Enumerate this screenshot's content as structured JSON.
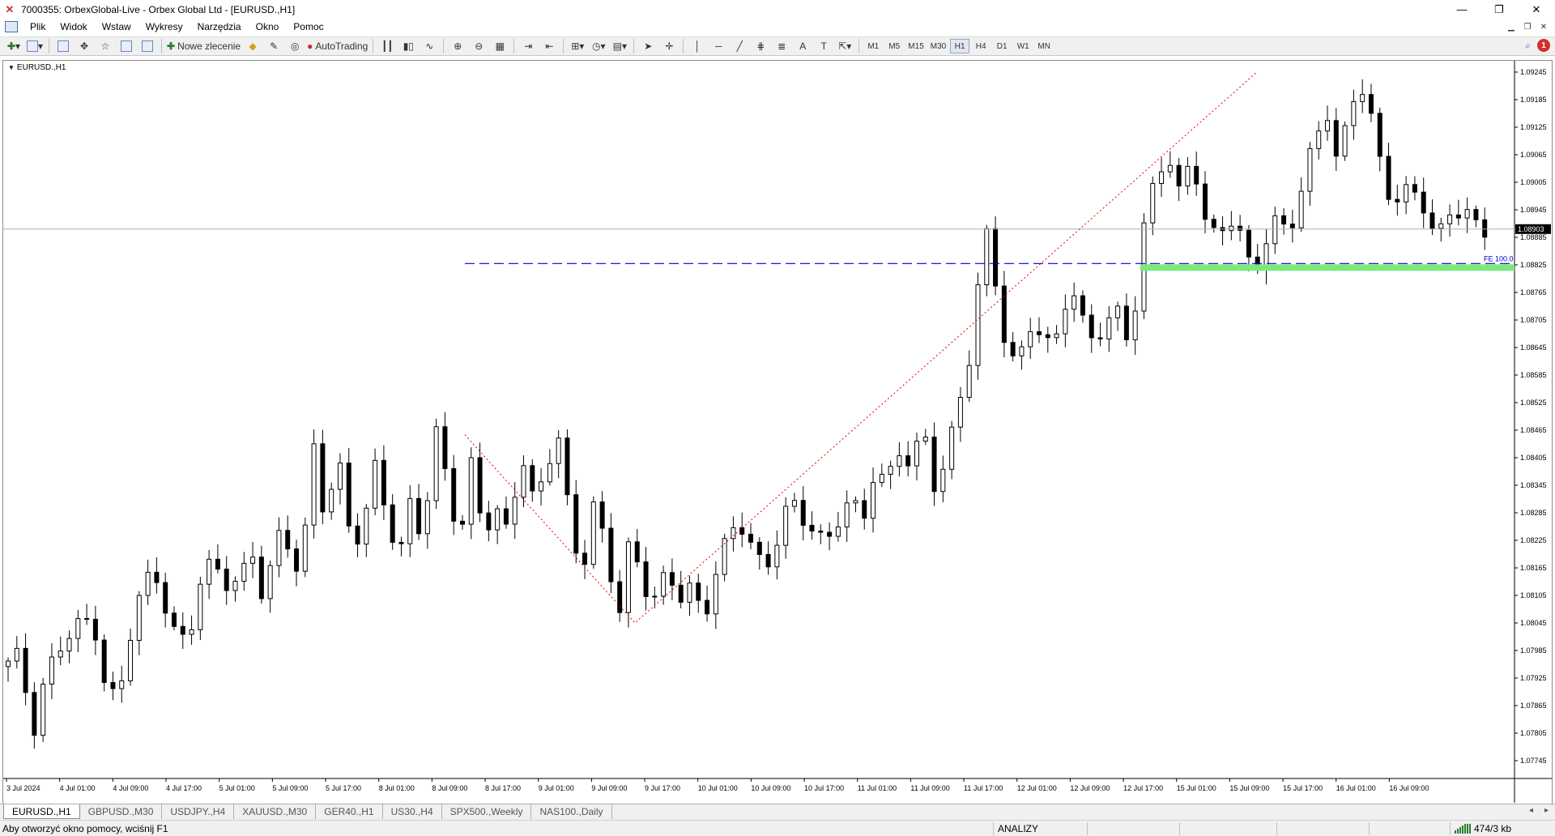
{
  "window": {
    "title": "7000355: OrbexGlobal-Live - Orbex Global Ltd - [EURUSD.,H1]",
    "minimize": "—",
    "maximize": "❐",
    "close": "✕"
  },
  "menu": [
    "Plik",
    "Widok",
    "Wstaw",
    "Wykresy",
    "Narzędzia",
    "Okno",
    "Pomoc"
  ],
  "toolbar": {
    "new_order_label": "Nowe zlecenie",
    "autotrading_label": "AutoTrading",
    "timeframes": [
      "M1",
      "M5",
      "M15",
      "M30",
      "H1",
      "H4",
      "D1",
      "W1",
      "MN"
    ],
    "active_timeframe": "H1",
    "notification_count": "1"
  },
  "chart": {
    "symbol_label": "EURUSD.,H1",
    "current_price_label": "1.08903",
    "fe_label": "FE 100.0",
    "background": "#ffffff",
    "candle_color": "#000000",
    "target_zone_color": "#7de87d",
    "fe_line_color": "#0000cc",
    "trend_line_color": "#e00000"
  },
  "chart_data": {
    "type": "candlestick",
    "symbol": "EURUSD.",
    "timeframe": "H1",
    "y_ticks": [
      "1.09245",
      "1.09185",
      "1.09125",
      "1.09065",
      "1.09005",
      "1.08945",
      "1.08885",
      "1.08825",
      "1.08765",
      "1.08705",
      "1.08645",
      "1.08585",
      "1.08525",
      "1.08465",
      "1.08405",
      "1.08345",
      "1.08285",
      "1.08225",
      "1.08165",
      "1.08105",
      "1.08045",
      "1.07985",
      "1.07925",
      "1.07865",
      "1.07805",
      "1.07745"
    ],
    "x_ticks": [
      "3 Jul 2024",
      "4 Jul 01:00",
      "4 Jul 09:00",
      "4 Jul 17:00",
      "5 Jul 01:00",
      "5 Jul 09:00",
      "5 Jul 17:00",
      "8 Jul 01:00",
      "8 Jul 09:00",
      "8 Jul 17:00",
      "9 Jul 01:00",
      "9 Jul 09:00",
      "9 Jul 17:00",
      "10 Jul 01:00",
      "10 Jul 09:00",
      "10 Jul 17:00",
      "11 Jul 01:00",
      "11 Jul 09:00",
      "11 Jul 17:00",
      "12 Jul 01:00",
      "12 Jul 09:00",
      "12 Jul 17:00",
      "15 Jul 01:00",
      "15 Jul 09:00",
      "15 Jul 17:00",
      "16 Jul 01:00",
      "16 Jul 09:00"
    ],
    "ylim": [
      1.07745,
      1.0928
    ],
    "current_price": 1.08903,
    "fe_level": 1.08828,
    "fibo_points": [
      1.08455,
      1.08045,
      1.09245
    ],
    "ohlc_path": [
      1.0795,
      1.0797,
      1.0781,
      1.0793,
      1.0798,
      1.0801,
      1.0804,
      1.0806,
      1.0791,
      1.0787,
      1.0801,
      1.0812,
      1.0817,
      1.0808,
      1.0799,
      1.0803,
      1.0816,
      1.0818,
      1.0814,
      1.0813,
      1.0819,
      1.0808,
      1.0825,
      1.0823,
      1.0813,
      1.0843,
      1.0826,
      1.0842,
      1.0826,
      1.0822,
      1.0838,
      1.0829,
      1.0818,
      1.0833,
      1.0822,
      1.0845,
      1.0836,
      1.0822,
      1.0841,
      1.0824,
      1.0827,
      1.0824,
      1.0843,
      1.0832,
      1.0837,
      1.0845,
      1.0827,
      1.0816,
      1.0831,
      1.0821,
      1.0804,
      1.0823,
      1.0814,
      1.0811,
      1.0815,
      1.0809,
      1.0812,
      1.0806,
      1.0817,
      1.0823,
      1.0825,
      1.0821,
      1.0816,
      1.0824,
      1.0831,
      1.0826,
      1.0825,
      1.0822,
      1.0828,
      1.0832,
      1.0824,
      1.0838,
      1.0836,
      1.0843,
      1.0839,
      1.0845,
      1.0833,
      1.0843,
      1.0854,
      1.0865,
      1.089,
      1.0877,
      1.0862,
      1.0864,
      1.0871,
      1.0863,
      1.0867,
      1.088,
      1.0871,
      1.0866,
      1.0868,
      1.0872,
      1.0866,
      1.089,
      1.0902,
      1.0905,
      1.0897,
      1.0909,
      1.0893,
      1.0888,
      1.0892,
      1.0888,
      1.0882,
      1.0888,
      1.0892,
      1.0889,
      1.0898,
      1.0911,
      1.0918,
      1.0902,
      1.0918,
      1.092,
      1.0912,
      1.09,
      1.0895,
      1.0899,
      1.0895,
      1.0888,
      1.0896,
      1.0893,
      1.0891,
      1.089
    ]
  },
  "tabs": [
    "EURUSD.,H1",
    "GBPUSD.,M30",
    "USDJPY.,H4",
    "XAUUSD.,M30",
    "GER40.,H1",
    "US30.,H4",
    "SPX500.,Weekly",
    "NAS100.,Daily"
  ],
  "status": {
    "help": "Aby otworzyć okno pomocy, wciśnij F1",
    "analysis": "ANALIZY",
    "traffic": "474/3 kb"
  }
}
